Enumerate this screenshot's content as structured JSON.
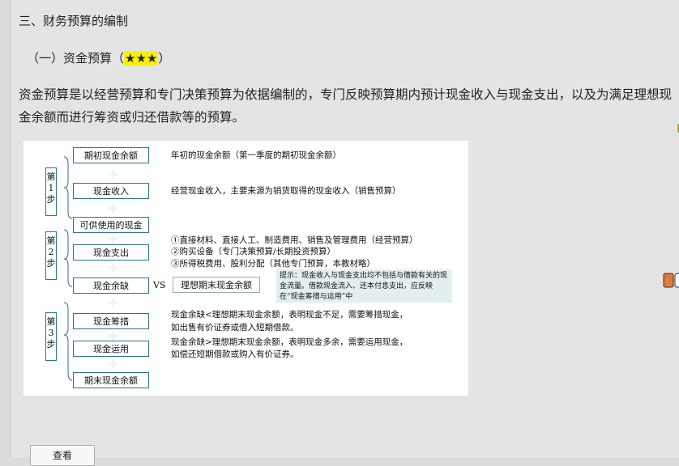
{
  "section": {
    "heading": "三、财务预算的编制",
    "subheading_prefix": "（一）资金预算（",
    "stars": "★★★",
    "subheading_suffix": "）",
    "paragraph": "资金预算是以经营预算和专门决策预算为依据编制的，专门反映预算期内预计现金收入与现金支出，以及为满足理想现金余额而进行筹资或归还借款等的预算。"
  },
  "figure": {
    "steps": [
      "第\n1\n步",
      "第\n2\n步",
      "第\n3\n步"
    ],
    "boxes": {
      "opening": "期初现金余额",
      "receipts": "现金收入",
      "available": "可供使用的现金",
      "disbursements": "现金支出",
      "balance": "现金余缺",
      "financing": "现金筹措",
      "application": "现金运用",
      "closing": "期末现金余额"
    },
    "descriptions": {
      "opening": "年初的现金余额（第一季度的期初现金余额）",
      "receipts": "经营现金收入，主要来源为销货取得的现金收入（销售预算）",
      "disbursements_1": "①直接材料、直接人工、制造费用、销售及管理费用（经营预算）",
      "disbursements_2": "②购买设备（专门决策预算/长期投资预算）",
      "disbursements_3": "③所得税费用、股利分配（其他专门预算，本教材略）",
      "financing_1": "现金余缺<理想期末现金余额，表明现金不足，需要筹措现金，",
      "financing_2": "如出售有价证券或借入短期借款。",
      "application_1": "现金余缺>理想期末现金余额，表明现金多余，需要运用现金，",
      "application_2": "如偿还短期借款或购入有价证券。"
    },
    "vs": "VS",
    "ideal_box": "理想期末现金余额",
    "tip": "提示：现金收入与现金支出均不包括与借款有关的现金流量。借款现金流入、还本付息支出，应反映在“现金筹措与运用”中"
  },
  "colors": {
    "highlight": "#ffef00",
    "box_border": "#2f6f8f",
    "tip_background": "#e3eef0"
  },
  "icons": [
    "note-icon",
    "toggle-icon"
  ],
  "button": {
    "label": "查看"
  }
}
